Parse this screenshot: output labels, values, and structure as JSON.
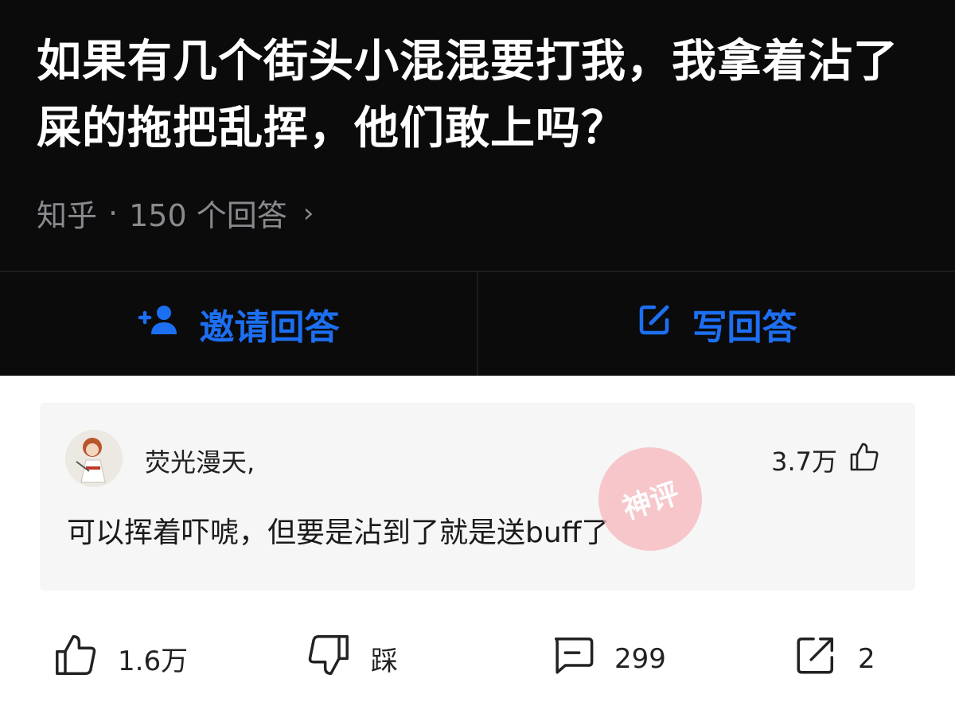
{
  "question": {
    "title": "如果有几个街头小混混要打我，我拿着沾了屎的拖把乱挥，他们敢上吗？",
    "source": "知乎",
    "separator": "·",
    "answer_count": "150 个回答",
    "chevron": "›"
  },
  "actions": {
    "invite_label": "邀请回答",
    "write_label": "写回答",
    "accent_color": "#1d6ff2"
  },
  "comment": {
    "username": "荧光漫天,",
    "likes": "3.7万",
    "content": "可以挥着吓唬，但要是沾到了就是送buff了"
  },
  "stamp": {
    "text": "神评"
  },
  "bottom": {
    "like_count": "1.6万",
    "dislike_label": "踩",
    "comment_count": "299",
    "share_count": "2"
  }
}
